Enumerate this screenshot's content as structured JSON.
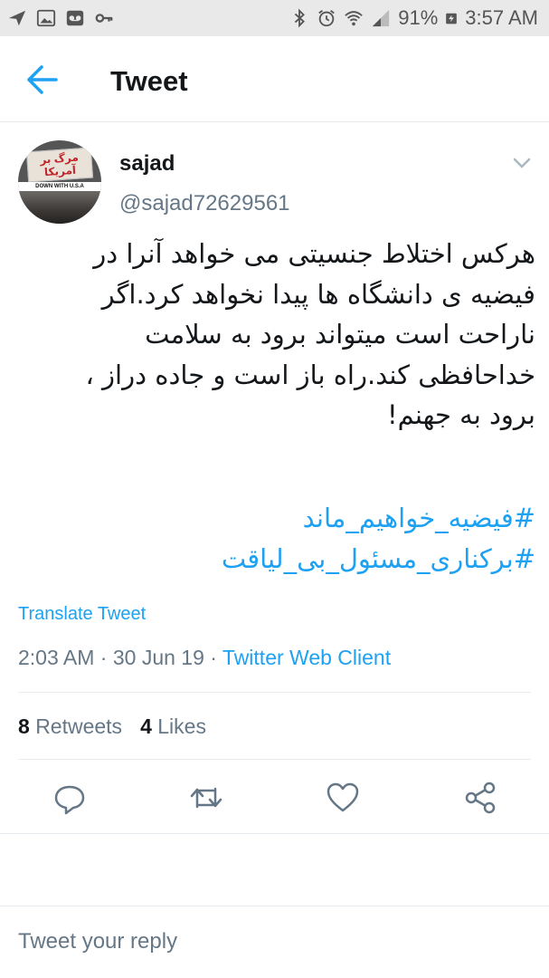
{
  "status_bar": {
    "battery": "91%",
    "time": "3:57 AM"
  },
  "app_bar": {
    "title": "Tweet",
    "back_icon": "arrow-left-icon"
  },
  "tweet": {
    "author": {
      "display_name": "sajad",
      "handle": "@sajad72629561",
      "avatar_text": "مرگ بر آمریکا",
      "avatar_banner": "DOWN WITH U.S.A"
    },
    "lines": [
      "هرکس اختلاط جنسیتی می خواهد آنرا در",
      "فیضیه ی دانشگاه ها پیدا نخواهد کرد.اگر",
      "ناراحت است میتواند برود به سلامت",
      "خداحافظی کند.راه باز است و جاده دراز ،",
      "برود به جهنم!"
    ],
    "hashtags": [
      "#فیضیه_خواهیم_ماند",
      "#برکناری_مسئول_بی_لیاقت"
    ],
    "translate_label": "Translate Tweet",
    "time": "2:03 AM",
    "date": "30 Jun 19",
    "separator": "·",
    "client": "Twitter Web Client",
    "retweets": {
      "count": "8",
      "label": "Retweets"
    },
    "likes": {
      "count": "4",
      "label": "Likes"
    }
  },
  "actions": [
    "reply-icon",
    "retweet-icon",
    "like-icon",
    "share-icon"
  ],
  "reply": {
    "placeholder": "Tweet your reply"
  },
  "colors": {
    "accent": "#1da1f2",
    "text": "#14171a",
    "secondary": "#657786",
    "status_bar_bg": "#e9e9e9"
  }
}
